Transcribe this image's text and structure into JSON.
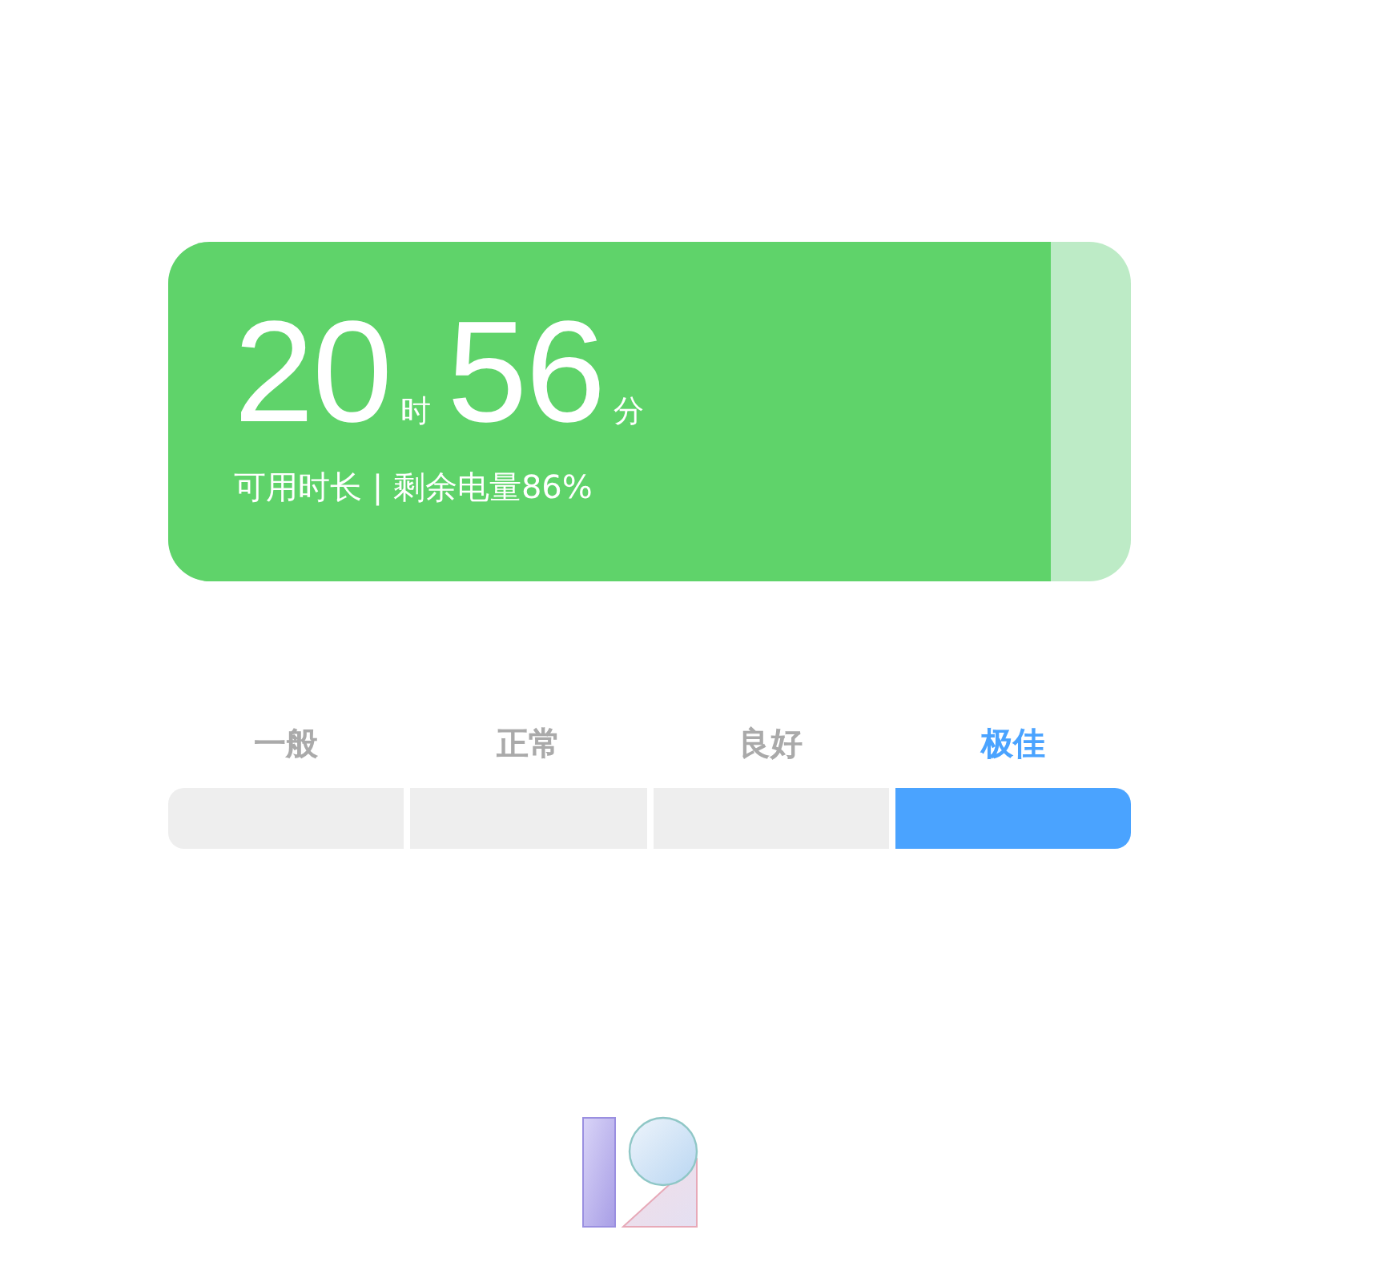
{
  "battery": {
    "hours": "20",
    "hours_unit": "时",
    "minutes": "56",
    "minutes_unit": "分",
    "caption": "可用时长 | 剩余电量86%",
    "level": 0.917
  },
  "rating": {
    "levels": [
      {
        "label": "一般",
        "selected": false
      },
      {
        "label": "正常",
        "selected": false
      },
      {
        "label": "良好",
        "selected": false
      },
      {
        "label": "极佳",
        "selected": true
      }
    ]
  }
}
